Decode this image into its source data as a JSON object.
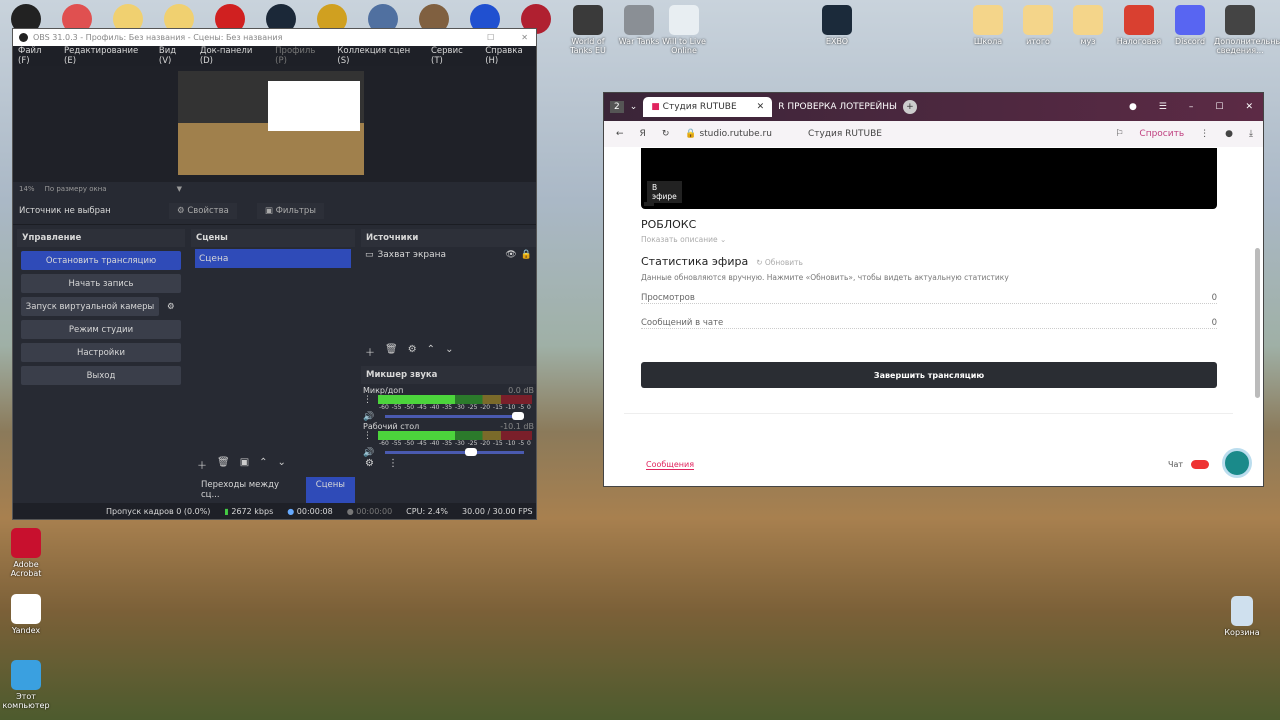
{
  "desktop": {
    "top_icons": [
      {
        "label": "World of Tanks EU",
        "color": "#3a3a3a"
      },
      {
        "label": "War Tanks",
        "color": "#8a8f95"
      },
      {
        "label": "Will to Live Online",
        "color": "#e8eef2"
      },
      {
        "label": "EXBO",
        "color": "#1b2a3a"
      },
      {
        "label": "Школа",
        "color": "#f4d58a"
      },
      {
        "label": "итого",
        "color": "#f4d58a"
      },
      {
        "label": "муз",
        "color": "#f4d58a"
      },
      {
        "label": "Налоговая",
        "color": "#d94030"
      },
      {
        "label": "Discord",
        "color": "#5865f2"
      },
      {
        "label": "Дополнительные сведения...",
        "color": "#444"
      }
    ],
    "left_icons": [
      {
        "label": "Adobe Acrobat",
        "color": "#c8102e"
      },
      {
        "label": "Yandex",
        "color": "#fff"
      },
      {
        "label": "Этот компьютер",
        "color": "#3aa0e0"
      }
    ],
    "right_icons": [
      {
        "label": "Корзина",
        "color": "#cfe0ee"
      }
    ]
  },
  "obs": {
    "title": "OBS 31.0.3 - Профиль: Без названия - Сцены: Без названия",
    "menu": [
      "Файл (F)",
      "Редактирование (E)",
      "Вид (V)",
      "Док-панели (D)",
      "Профиль (P)",
      "Коллекция сцен (S)",
      "Сервис (T)",
      "Справка (H)"
    ],
    "zoom": "14%",
    "zoom_mode": "По размеру окна",
    "no_source": "Источник не выбран",
    "properties": "Свойства",
    "filters": "Фильтры",
    "controls_title": "Управление",
    "controls": [
      "Остановить трансляцию",
      "Начать запись",
      "Запуск виртуальной камеры",
      "Режим студии",
      "Настройки",
      "Выход"
    ],
    "scenes_title": "Сцены",
    "scenes": [
      "Сцена"
    ],
    "sources_title": "Источники",
    "sources": [
      "Захват экрана"
    ],
    "transitions_tab": "Переходы между сц...",
    "scenes_tab": "Сцены",
    "mixer_title": "Микшер звука",
    "ticks": [
      "-60",
      "-55",
      "-50",
      "-45",
      "-40",
      "-35",
      "-30",
      "-25",
      "-20",
      "-15",
      "-10",
      "-5",
      "0"
    ],
    "channels": [
      {
        "name": "Микр/доп",
        "db": "0.0 dB",
        "volume": 1.0
      },
      {
        "name": "Рабочий стол",
        "db": "-10.1 dB",
        "volume": 0.66
      }
    ],
    "status": {
      "dropped": "Пропуск кадров 0 (0.0%)",
      "bitrate": "2672 kbps",
      "stream_time": "00:00:08",
      "rec_time": "00:00:00",
      "cpu": "CPU: 2.4%",
      "fps": "30.00 / 30.00 FPS"
    }
  },
  "browser": {
    "tab_count": "2",
    "tabs": [
      "Студия RUTUBE",
      "ПРОВЕРКА ЛОТЕРЕЙНЫ"
    ],
    "url": "studio.rutube.ru",
    "page_title": "Студия RUTUBE",
    "ask": "Спросить",
    "live_badge": "В эфире",
    "stream_name": "РОБЛОКС",
    "show_desc": "Показать описание ⌄",
    "stats_title": "Статистика эфира",
    "refresh": "Обновить",
    "stats_note": "Данные обновляются вручную. Нажмите «Обновить», чтобы видеть актуальную статистику",
    "stats": [
      {
        "label": "Просмотров",
        "value": "0"
      },
      {
        "label": "Сообщений в чате",
        "value": "0"
      }
    ],
    "end_button": "Завершить трансляцию",
    "messages_tab": "Сообщения",
    "chat_label": "Чат"
  }
}
